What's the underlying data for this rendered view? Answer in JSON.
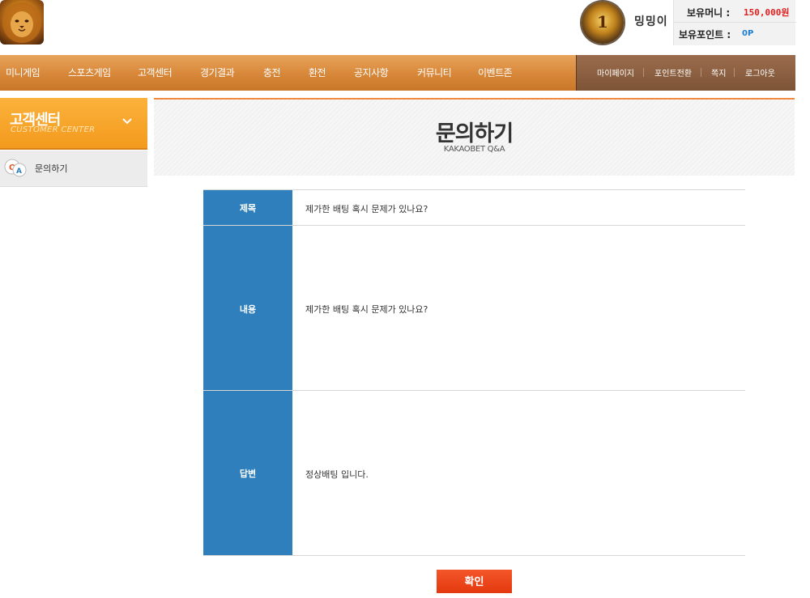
{
  "header": {
    "user": {
      "level": "1",
      "nickname": "밍밍이",
      "money_label": "보유머니 :",
      "money_value": "150,000원",
      "point_label": "보유포인트 :",
      "point_value": "0P"
    }
  },
  "nav": {
    "items": [
      "미니게임",
      "스포츠게임",
      "고객센터",
      "경기결과",
      "충전",
      "환전",
      "공지사항",
      "커뮤니티",
      "이벤트존"
    ],
    "sub_items": [
      "마이페이지",
      "포인트전환",
      "쪽지",
      "로그아웃"
    ]
  },
  "sidebar": {
    "title": "고객센터",
    "subtitle": "CUSTOMER CENTER",
    "items": [
      {
        "label": "문의하기",
        "icon": "qa-bubble-icon"
      }
    ]
  },
  "main": {
    "title": "문의하기",
    "subtitle": "KAKAOBET Q&A",
    "rows": [
      {
        "header": "제목",
        "value": "제가한 배팅 혹시 문제가 있나요?"
      },
      {
        "header": "내용",
        "value": "제가한 배팅 혹시 문제가 있나요?"
      },
      {
        "header": "답변",
        "value": "정상배팅 입니다."
      }
    ],
    "confirm_label": "확인"
  },
  "colors": {
    "nav_orange": "#d9893b",
    "nav_brown": "#7e5436",
    "sidebar_orange": "#f39a1d",
    "table_header_blue": "#2f7fbd",
    "confirm_red": "#e4380e",
    "money_red": "#e02020",
    "point_blue": "#1e7fd0"
  }
}
